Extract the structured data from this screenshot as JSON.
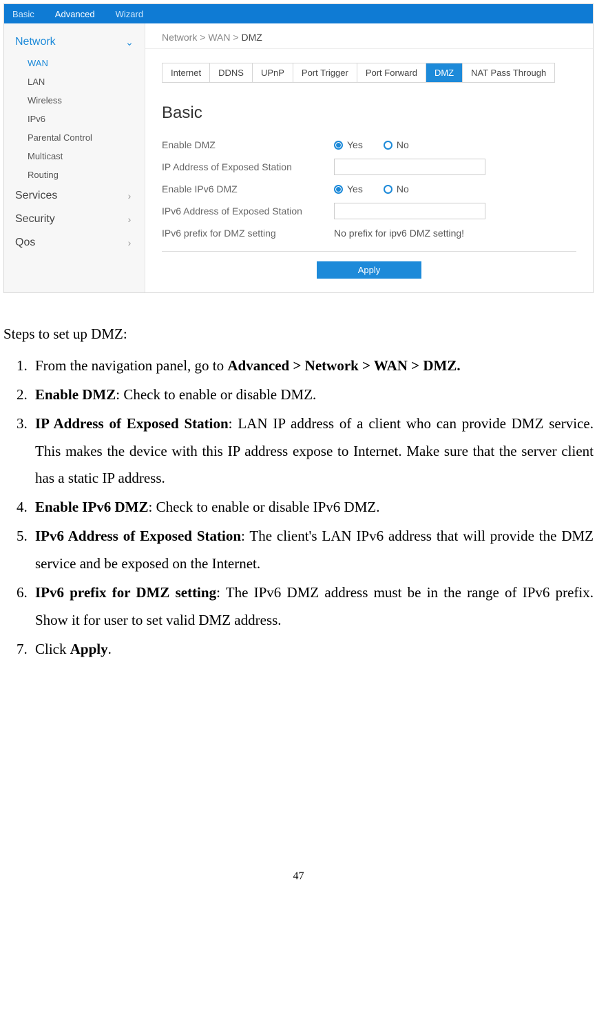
{
  "topbar": {
    "tabs": [
      "Basic",
      "Advanced",
      "Wizard"
    ],
    "active": "Advanced"
  },
  "sidebar": {
    "sections": [
      {
        "label": "Network",
        "expanded": true,
        "items": [
          "WAN",
          "LAN",
          "Wireless",
          "IPv6",
          "Parental Control",
          "Multicast",
          "Routing"
        ],
        "activeItem": "WAN"
      },
      {
        "label": "Services",
        "expanded": false
      },
      {
        "label": "Security",
        "expanded": false
      },
      {
        "label": "Qos",
        "expanded": false
      }
    ]
  },
  "breadcrumb": {
    "a": "Network",
    "b": "WAN",
    "c": "DMZ"
  },
  "tabstrip": {
    "items": [
      "Internet",
      "DDNS",
      "UPnP",
      "Port Trigger",
      "Port Forward",
      "DMZ",
      "NAT Pass Through"
    ],
    "active": "DMZ"
  },
  "section_title": "Basic",
  "form": {
    "enable_dmz_label": "Enable DMZ",
    "ip_exposed_label": "IP Address of Exposed Station",
    "enable_ipv6_dmz_label": "Enable IPv6 DMZ",
    "ipv6_exposed_label": "IPv6 Address of Exposed Station",
    "ipv6_prefix_label": "IPv6 prefix for DMZ setting",
    "ipv6_prefix_msg": "No prefix for ipv6 DMZ setting!",
    "yes": "Yes",
    "no": "No",
    "apply": "Apply"
  },
  "instructions": {
    "intro": "Steps to set up DMZ:",
    "step1_a": "From the navigation panel, go to ",
    "step1_b": "Advanced > Network > WAN > DMZ.",
    "step2_b": "Enable DMZ",
    "step2_a": ": Check to enable or disable DMZ.",
    "step3_b": "IP Address of Exposed Station",
    "step3_a": ": LAN IP address of a client who can provide DMZ service. This makes the device with this IP address expose to Internet. Make sure that the server client has a static IP address.",
    "step4_b": "Enable IPv6 DMZ",
    "step4_a": ": Check to enable or disable IPv6 DMZ.",
    "step5_b": "IPv6 Address of Exposed Station",
    "step5_a": ": The client's LAN IPv6 address that will provide the DMZ service and be exposed on the Internet.",
    "step6_b": "IPv6 prefix for DMZ setting",
    "step6_a": ": The IPv6 DMZ address must be in the range of IPv6 prefix. Show it for user to set valid DMZ address.",
    "step7_a": "Click ",
    "step7_b": "Apply",
    "step7_c": "."
  },
  "page_number": "47"
}
